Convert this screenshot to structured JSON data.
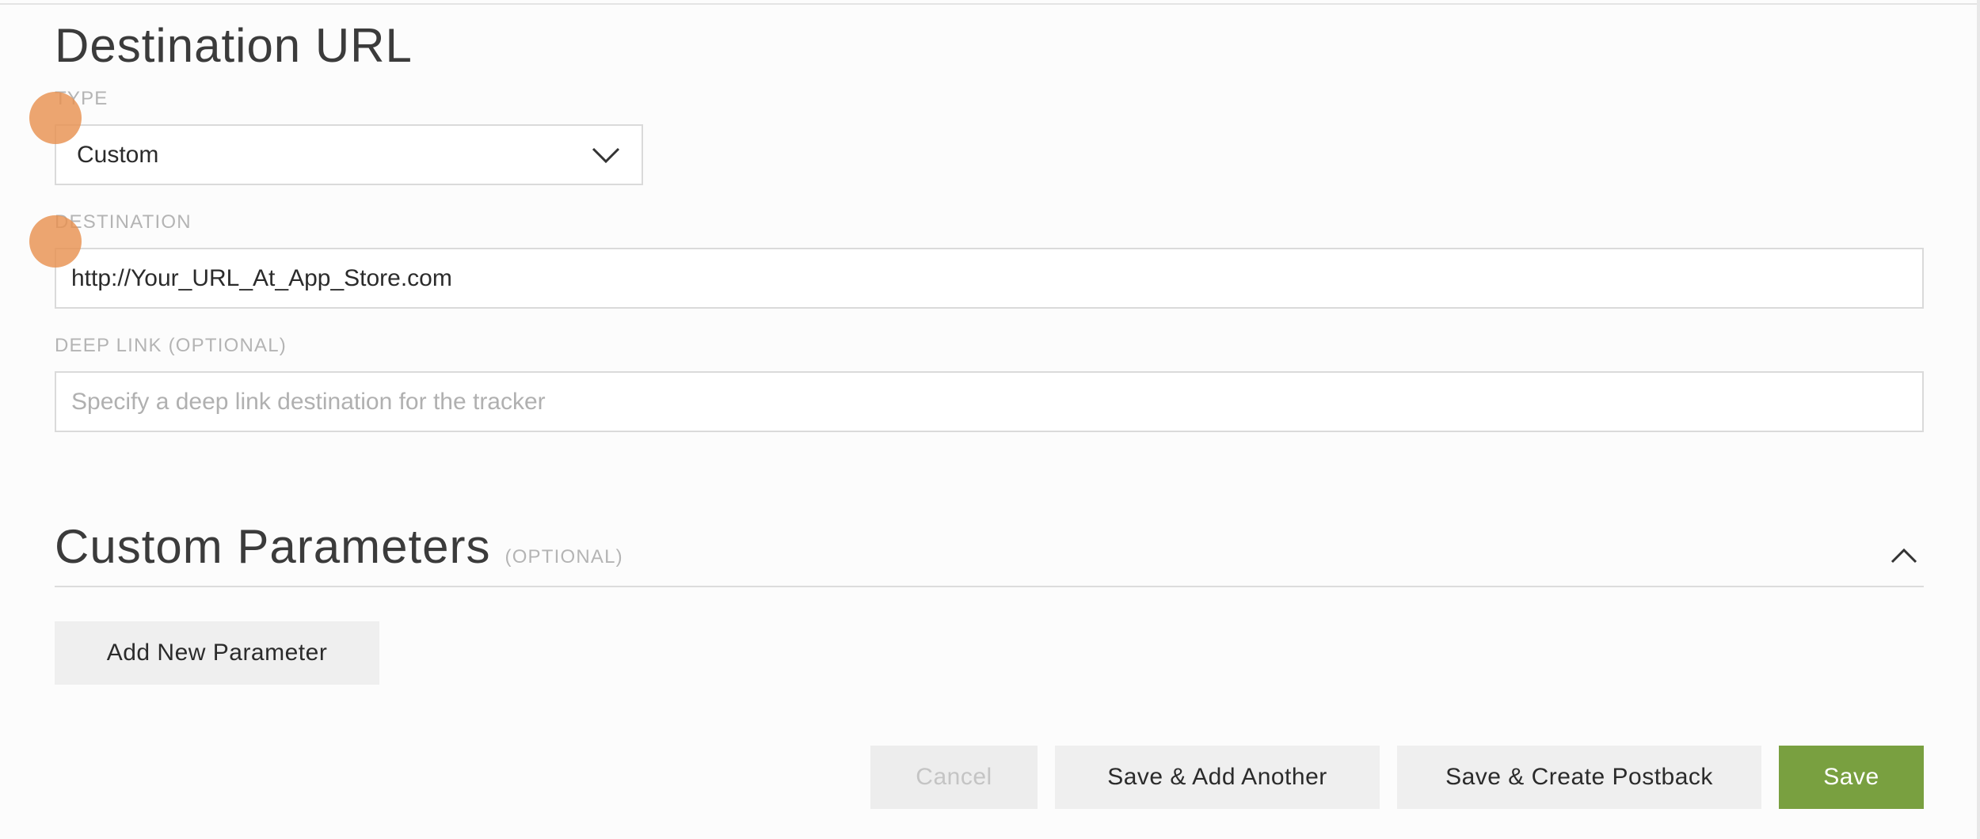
{
  "destination_section": {
    "title": "Destination URL",
    "type_field": {
      "label": "TYPE",
      "selected_value": "Custom"
    },
    "destination_field": {
      "label": "DESTINATION",
      "value": "http://Your_URL_At_App_Store.com"
    },
    "deep_link_field": {
      "label": "DEEP LINK (OPTIONAL)",
      "value": "",
      "placeholder": "Specify a deep link destination for the tracker"
    }
  },
  "custom_parameters_section": {
    "title": "Custom Parameters",
    "subtitle": "(OPTIONAL)",
    "add_button_label": "Add New Parameter",
    "expanded": true
  },
  "footer": {
    "cancel_label": "Cancel",
    "save_add_another_label": "Save & Add Another",
    "save_create_postback_label": "Save & Create Postback",
    "save_label": "Save"
  },
  "colors": {
    "primary_button": "#79a040",
    "marker": "#e89150",
    "label_text": "#b4b4b4",
    "input_border": "#dadada"
  },
  "icons": {
    "type_select": "chevron-down-icon",
    "section_toggle": "chevron-up-icon"
  }
}
